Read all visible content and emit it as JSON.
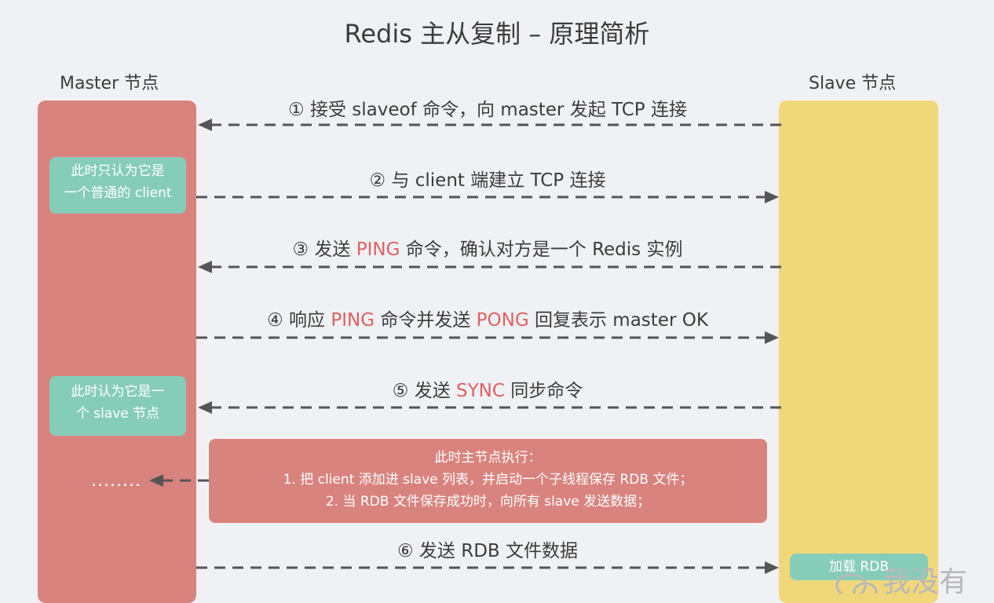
{
  "title": "Redis 主从复制 – 原理简析",
  "master": {
    "label": "Master 节点",
    "note_client": [
      "此时只认为它是",
      "一个普通的 client"
    ],
    "note_slave": [
      "此时认为它是一",
      "个 slave 节点"
    ],
    "ellipsis": "........"
  },
  "slave": {
    "label": "Slave 节点",
    "rdb_label": "加载 RDB"
  },
  "steps": [
    {
      "num": "①",
      "parts": [
        "接受 slaveof 命令，向 master 发起 TCP 连接"
      ],
      "direction": "to-master"
    },
    {
      "num": "②",
      "parts": [
        "与 client 端建立 TCP 连接"
      ],
      "direction": "to-slave"
    },
    {
      "num": "③",
      "parts": [
        "发送 ",
        "PING",
        " 命令，确认对方是一个 Redis 实例"
      ],
      "direction": "to-master"
    },
    {
      "num": "④",
      "parts": [
        "响应 ",
        "PING",
        " 命令并发送 ",
        "PONG",
        " 回复表示 master OK"
      ],
      "direction": "to-slave"
    },
    {
      "num": "⑤",
      "parts": [
        "发送 ",
        "SYNC",
        " 同步命令"
      ],
      "direction": "to-master"
    },
    {
      "num": "⑥",
      "parts": [
        "发送 RDB 文件数据"
      ],
      "direction": "to-slave"
    }
  ],
  "exec_box": {
    "title": "此时主节点执行：",
    "line1": "1. 把 client 添加进 slave 列表，并启动一个子线程保存 RDB 文件；",
    "line2": "2. 当 RDB 文件保存成功时，向所有 slave 发送数据；"
  },
  "watermark": "我没有",
  "colors": {
    "master": "#d9837e",
    "slave": "#f0d77a",
    "note": "#86cdb9",
    "highlight": "#e06060",
    "arrow": "#555555"
  }
}
